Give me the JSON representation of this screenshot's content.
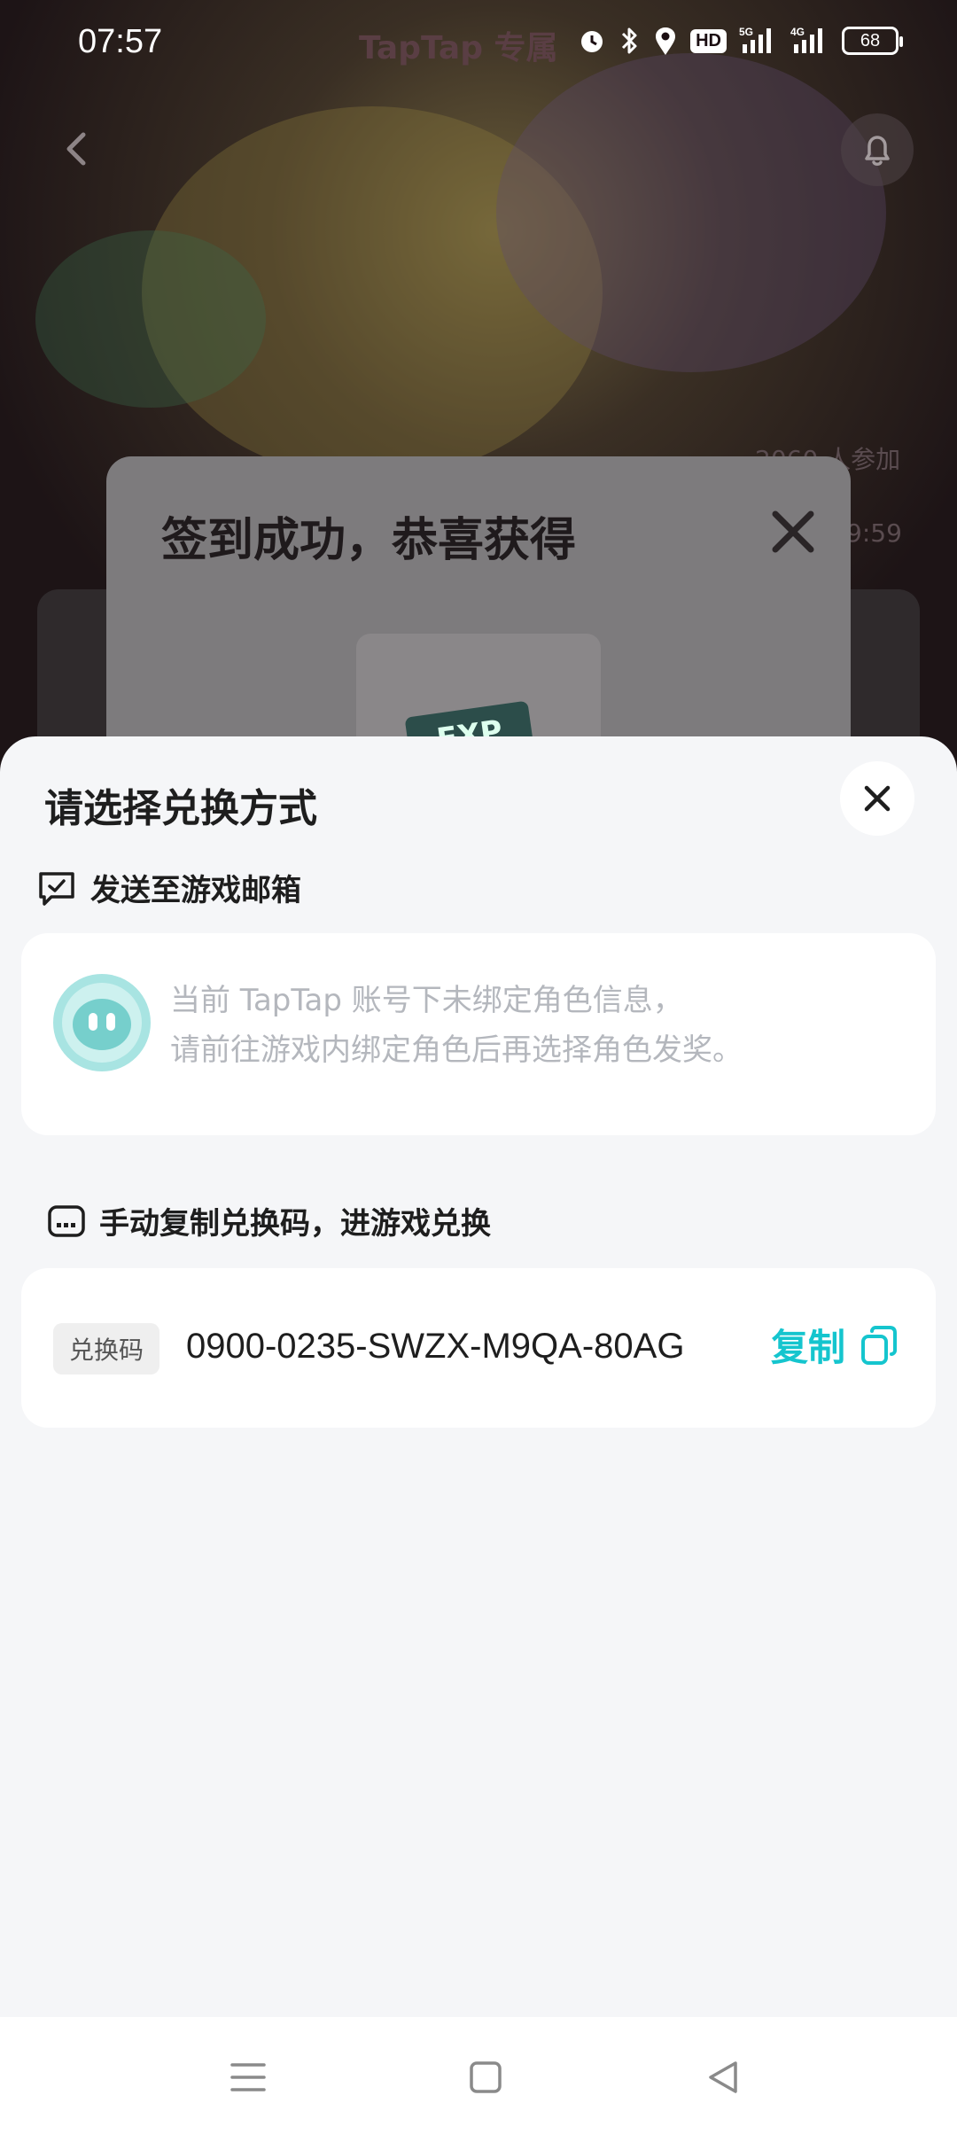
{
  "status_bar": {
    "time": "07:57",
    "network_badge": "HD",
    "network_type_1": "5G",
    "network_type_2": "4G",
    "battery": "68"
  },
  "background": {
    "watermark": "TapTap 专属",
    "participants_text": "2060 人参加",
    "timer_text": "9:59",
    "reward_tag": "EXP"
  },
  "dialog": {
    "title": "签到成功，恭喜获得"
  },
  "sheet": {
    "title": "请选择兑换方式",
    "mail_section": {
      "label": "发送至游戏邮箱",
      "message_line1": "当前 TapTap 账号下未绑定角色信息，",
      "message_line2": "请前往游戏内绑定角色后再选择角色发奖。"
    },
    "code_section": {
      "label": "手动复制兑换码，进游戏兑换",
      "tag": "兑换码",
      "code": "0900-0235-SWZX-M9QA-80AG",
      "copy_label": "复制"
    }
  },
  "colors": {
    "accent": "#15c5ce",
    "sheet_bg": "#f5f6f8",
    "card_bg": "#ffffff",
    "muted_text": "#b4b7bd"
  },
  "icons": [
    "back-icon",
    "bell-icon",
    "close-icon",
    "mailbox-icon",
    "code-icon",
    "copy-icon",
    "menu-icon",
    "home-icon",
    "nav-back-icon"
  ]
}
